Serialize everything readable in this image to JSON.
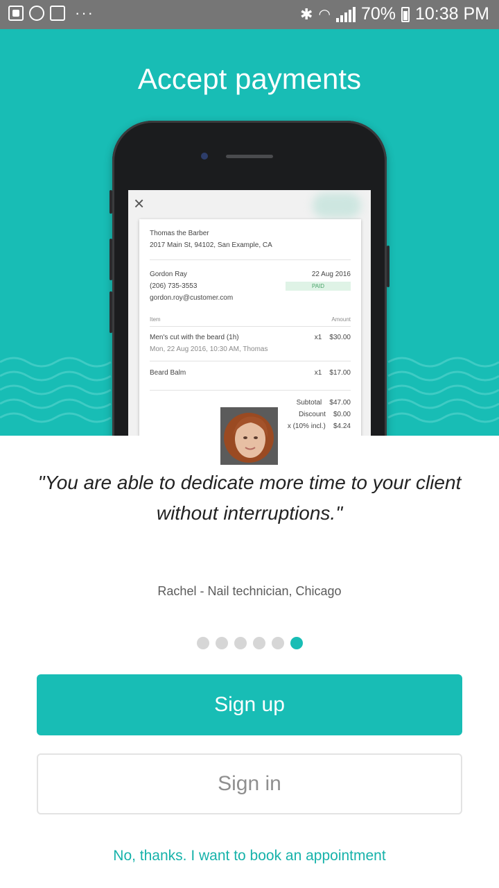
{
  "status_bar": {
    "battery": "70%",
    "time": "10:38 PM",
    "left_icons": [
      "gallery-icon",
      "sync-icon",
      "mail-icon"
    ],
    "overflow": "···"
  },
  "hero": {
    "title": "Accept payments",
    "background_color": "#18bdb5"
  },
  "receipt": {
    "close": "×",
    "business_name": "Thomas the Barber",
    "business_address": "2017 Main St, 94102, San Example, CA",
    "customer_name": "Gordon Ray",
    "customer_phone": "(206) 735-3553",
    "customer_email": "gordon.roy@customer.com",
    "date": "22 Aug 2016",
    "status": "PAID",
    "col_item": "Item",
    "col_amount": "Amount",
    "items": [
      {
        "name": "Men's cut with the beard (1h)",
        "detail": "Mon, 22 Aug 2016, 10:30 AM, Thomas",
        "qty": "x1",
        "amount": "$30.00"
      },
      {
        "name": "Beard Balm",
        "detail": "",
        "qty": "x1",
        "amount": "$17.00"
      }
    ],
    "totals": [
      {
        "label": "Subtotal",
        "value": "$47.00"
      },
      {
        "label": "Discount",
        "value": "$0.00"
      },
      {
        "label": "x (10% incl.)",
        "value": "$4.24"
      }
    ]
  },
  "testimonial": {
    "quote": "\"You are able to dedicate more time to your client without interruptions.\"",
    "author": "Rachel - Nail technician, Chicago"
  },
  "pager": {
    "count": 6,
    "active_index": 5
  },
  "actions": {
    "signup_label": "Sign up",
    "signin_label": "Sign in",
    "book_link": "No, thanks. I want to book an appointment"
  },
  "colors": {
    "accent": "#18bdb5",
    "link": "#16b2aa"
  }
}
